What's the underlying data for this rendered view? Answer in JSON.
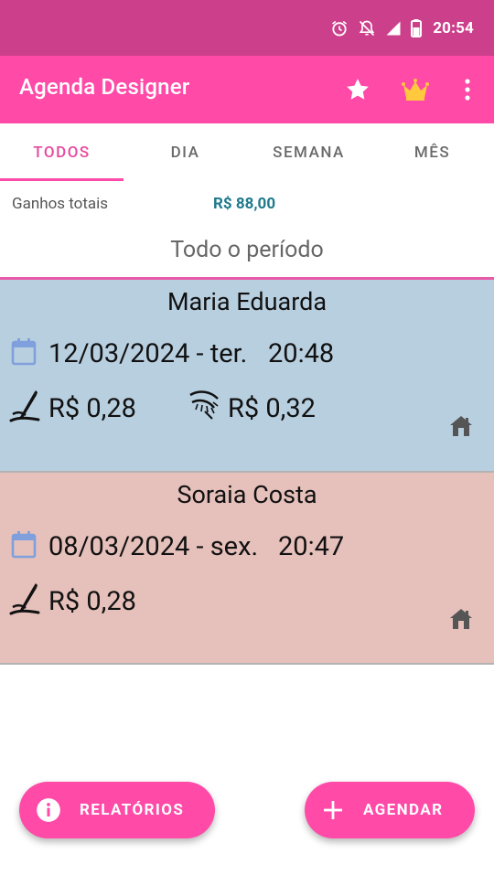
{
  "status_bar": {
    "time": "20:54",
    "icons": [
      "alarm-icon",
      "notifications-off-icon",
      "signal-icon",
      "battery-icon"
    ]
  },
  "app_bar": {
    "title": "Agenda Designer",
    "actions": [
      "star-icon",
      "crown-icon",
      "more-vert-icon"
    ]
  },
  "tabs": [
    {
      "label": "TODOS",
      "active": true
    },
    {
      "label": "DIA",
      "active": false
    },
    {
      "label": "SEMANA",
      "active": false
    },
    {
      "label": "MÊS",
      "active": false
    }
  ],
  "summary": {
    "label": "Ganhos totais",
    "value": "R$ 88,00"
  },
  "period": "Todo o período",
  "appointments": [
    {
      "client": "Maria Eduarda",
      "date": "12/03/2024 - ter.",
      "time": "20:48",
      "services": [
        {
          "icon": "brow-pencil-icon",
          "price": "R$ 0,28"
        },
        {
          "icon": "eyelash-icon",
          "price": "R$ 0,32"
        }
      ],
      "location_icon": "home-icon",
      "color": "#b8cfe0"
    },
    {
      "client": "Soraia Costa",
      "date": "08/03/2024 - sex.",
      "time": "20:47",
      "services": [
        {
          "icon": "brow-pencil-icon",
          "price": "R$ 0,28"
        }
      ],
      "location_icon": "home-icon",
      "color": "#e6c0bb"
    }
  ],
  "fab": {
    "reports_label": "RELATÓRIOS",
    "schedule_label": "AGENDAR"
  },
  "colors": {
    "primary": "#ff4aa8",
    "status_bar": "#cc3f8a",
    "accent_text": "#1f7a8c"
  }
}
